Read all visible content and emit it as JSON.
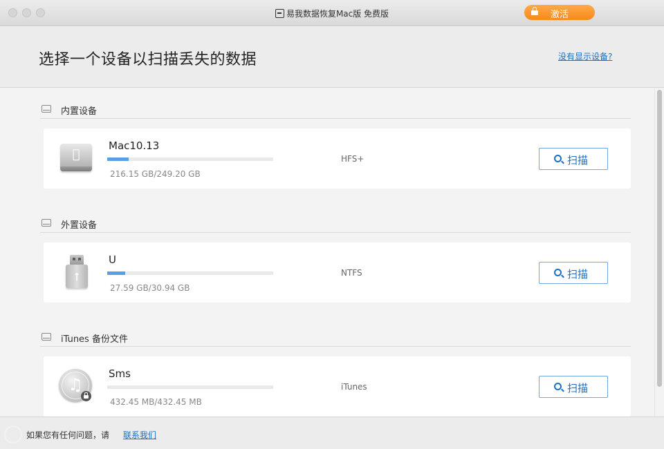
{
  "window": {
    "title": "易我数据恢复Mac版 免费版",
    "activate_label": "激活"
  },
  "header": {
    "title": "选择一个设备以扫描丢失的数据",
    "no_device_link": "没有显示设备?"
  },
  "sections": [
    {
      "label": "内置设备",
      "device": {
        "name": "Mac10.13",
        "size": "216.15 GB/249.20 GB",
        "used_fraction": 0.13,
        "fs": "HFS+",
        "scan_label": "扫描",
        "icon": "hard-drive-apple-icon"
      }
    },
    {
      "label": "外置设备",
      "device": {
        "name": "U",
        "size": "27.59 GB/30.94 GB",
        "used_fraction": 0.11,
        "fs": "NTFS",
        "scan_label": "扫描",
        "icon": "usb-drive-icon"
      }
    },
    {
      "label": "iTunes 备份文件",
      "device": {
        "name": "Sms",
        "size": "432.45 MB/432.45 MB",
        "used_fraction": 0.0,
        "fs": "iTunes",
        "scan_label": "扫描",
        "icon": "itunes-icon"
      }
    }
  ],
  "footer": {
    "text": "如果您有任何问题，请",
    "link": "联系我们"
  },
  "colors": {
    "accent": "#1a6fc4",
    "activate": "#f78a1a",
    "progress": "#5a9ee8"
  }
}
